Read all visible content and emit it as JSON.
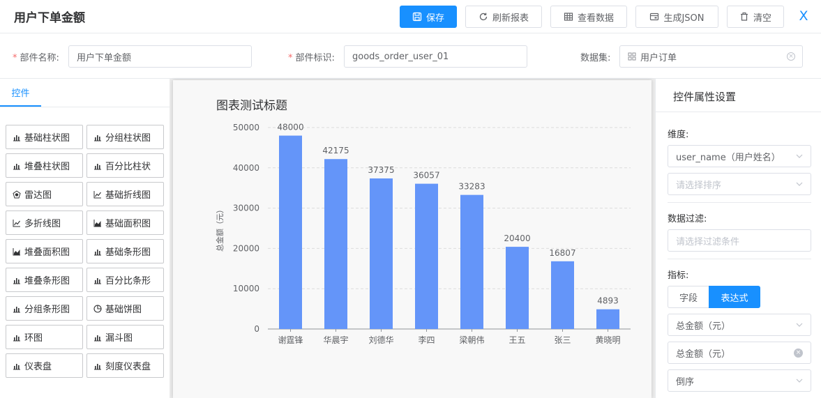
{
  "header": {
    "title": "用户下单金额",
    "buttons": {
      "save": "保存",
      "refresh": "刷新报表",
      "view_data": "查看数据",
      "gen_json": "生成JSON",
      "clear": "清空"
    },
    "close_glyph": "X"
  },
  "form": {
    "name_label": "部件名称:",
    "name_value": "用户下单金额",
    "id_label": "部件标识:",
    "id_value": "goods_order_user_01",
    "dataset_label": "数据集:",
    "dataset_value": "用户订单",
    "required_mark": "*"
  },
  "left_panel": {
    "tab_label": "控件",
    "widgets": [
      {
        "label": "基础柱状图",
        "icon": "bar-chart-icon"
      },
      {
        "label": "分组柱状图",
        "icon": "bar-chart-icon"
      },
      {
        "label": "堆叠柱状图",
        "icon": "bar-chart-icon"
      },
      {
        "label": "百分比柱状",
        "icon": "bar-chart-icon"
      },
      {
        "label": "雷达图",
        "icon": "radar-icon"
      },
      {
        "label": "基础折线图",
        "icon": "line-chart-icon"
      },
      {
        "label": "多折线图",
        "icon": "line-chart-icon"
      },
      {
        "label": "基础面积图",
        "icon": "area-chart-icon"
      },
      {
        "label": "堆叠面积图",
        "icon": "area-chart-icon"
      },
      {
        "label": "基础条形图",
        "icon": "bar-chart-icon"
      },
      {
        "label": "堆叠条形图",
        "icon": "bar-chart-icon"
      },
      {
        "label": "百分比条形",
        "icon": "bar-chart-icon"
      },
      {
        "label": "分组条形图",
        "icon": "bar-chart-icon"
      },
      {
        "label": "基础饼图",
        "icon": "pie-chart-icon"
      },
      {
        "label": "环图",
        "icon": "bar-chart-icon"
      },
      {
        "label": "漏斗图",
        "icon": "bar-chart-icon"
      },
      {
        "label": "仪表盘",
        "icon": "bar-chart-icon"
      },
      {
        "label": "刻度仪表盘",
        "icon": "bar-chart-icon"
      }
    ]
  },
  "chart_data": {
    "type": "bar",
    "title": "图表测试标题",
    "ylabel": "总金额（元）",
    "xlabel": "",
    "categories": [
      "谢霆锋",
      "华晨宇",
      "刘德华",
      "李四",
      "梁朝伟",
      "王五",
      "张三",
      "黄晓明"
    ],
    "values": [
      48000,
      42175,
      37375,
      36057,
      33283,
      20400,
      16807,
      4893
    ],
    "ylim": [
      0,
      50000
    ],
    "yticks": [
      0,
      10000,
      20000,
      30000,
      40000,
      50000
    ],
    "grid": true,
    "bar_color": "#6495f9"
  },
  "right_panel": {
    "title": "控件属性设置",
    "dimension_label": "维度:",
    "dimension_value": "user_name（用户姓名）",
    "sort_placeholder": "请选择排序",
    "filter_label": "数据过滤:",
    "filter_placeholder": "请选择过滤条件",
    "metric_label": "指标:",
    "seg_field": "字段",
    "seg_expr": "表达式",
    "metric_value": "总金额（元）",
    "metric_alias": "总金额（元）",
    "order_value": "倒序"
  },
  "colors": {
    "primary": "#1890ff",
    "bar": "#6495f9",
    "required": "#f56c6c"
  }
}
